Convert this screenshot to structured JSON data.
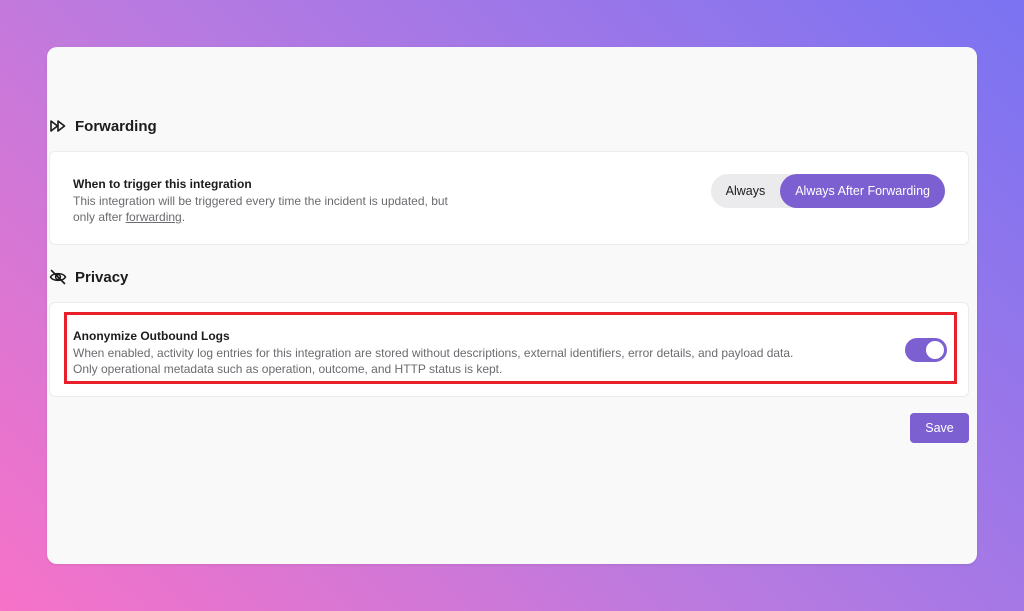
{
  "forwarding": {
    "heading": "Forwarding",
    "icon": "fast-forward-icon",
    "trigger_title": "When to trigger this integration",
    "trigger_desc_prefix": "This integration will be triggered every time the incident is updated, but",
    "trigger_desc_line2_prefix": "only after ",
    "trigger_desc_link": "forwarding",
    "trigger_desc_suffix": ".",
    "options": [
      "Always",
      "Always After Forwarding"
    ],
    "selected": "Always After Forwarding"
  },
  "privacy": {
    "heading": "Privacy",
    "icon": "eye-off-icon",
    "anonymize_title": "Anonymize Outbound Logs",
    "anonymize_desc_line1": "When enabled, activity log entries for this integration are stored without descriptions, external identifiers, error details, and payload data.",
    "anonymize_desc_line2": "Only operational metadata such as operation, outcome, and HTTP status is kept.",
    "anonymize_enabled": true
  },
  "actions": {
    "save_label": "Save"
  },
  "colors": {
    "accent": "#7c5fd0",
    "highlight": "#e8202a"
  }
}
